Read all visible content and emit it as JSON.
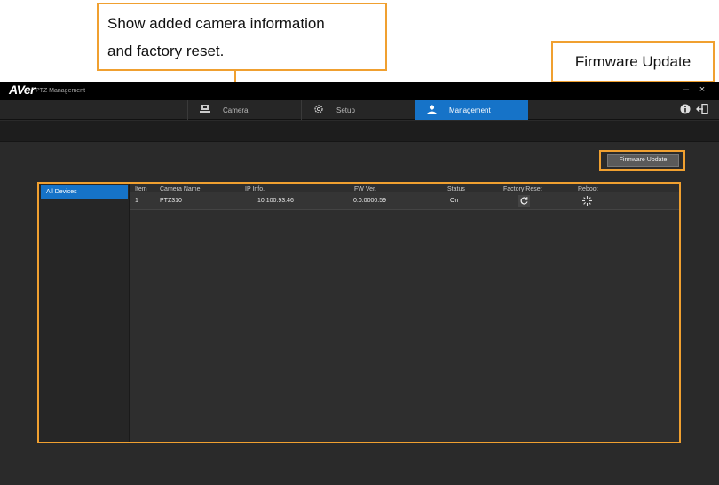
{
  "callouts": {
    "left_line1": "Show added camera information",
    "left_line2": "and factory reset.",
    "right": "Firmware Update"
  },
  "window": {
    "logo": "AVer",
    "title": "PTZ Management",
    "minimize": "–",
    "close": "×"
  },
  "nav": {
    "tabs": [
      {
        "label": "Camera",
        "icon": "camera-icon",
        "active": false
      },
      {
        "label": "Setup",
        "icon": "gear-icon",
        "active": false
      },
      {
        "label": "Management",
        "icon": "user-icon",
        "active": true
      }
    ],
    "right_icons": [
      "info-icon",
      "logout-icon"
    ]
  },
  "toolbar": {
    "firmware_update_label": "Firmware Update"
  },
  "sidebar": {
    "items": [
      {
        "label": "All Devices",
        "selected": true
      }
    ]
  },
  "table": {
    "columns": [
      "Item",
      "Camera Name",
      "IP Info.",
      "FW Ver.",
      "Status",
      "Factory Reset",
      "Reboot"
    ],
    "rows": [
      {
        "item": "1",
        "camera_name": "PTZ310",
        "ip": "10.100.93.46",
        "fw": "0.0.0000.59",
        "status": "On",
        "factory_reset_icon": "refresh-icon",
        "reboot_icon": "reboot-icon"
      }
    ]
  },
  "colors": {
    "accent_blue": "#1673c8",
    "callout_orange": "#f0a030",
    "titlebar": "#000000"
  }
}
